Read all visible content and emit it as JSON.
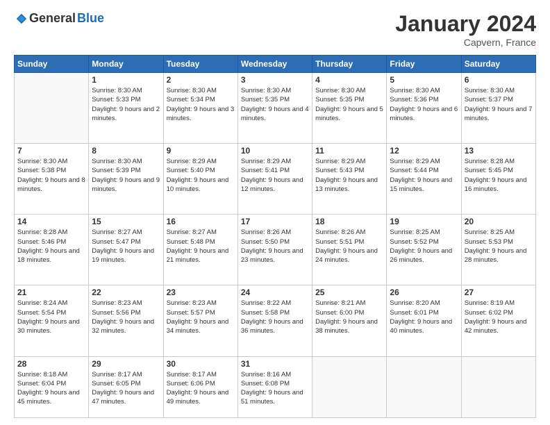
{
  "header": {
    "logo_general": "General",
    "logo_blue": "Blue",
    "month_title": "January 2024",
    "location": "Capvern, France"
  },
  "days_of_week": [
    "Sunday",
    "Monday",
    "Tuesday",
    "Wednesday",
    "Thursday",
    "Friday",
    "Saturday"
  ],
  "weeks": [
    [
      {
        "day": "",
        "sunrise": "",
        "sunset": "",
        "daylight": ""
      },
      {
        "day": "1",
        "sunrise": "Sunrise: 8:30 AM",
        "sunset": "Sunset: 5:33 PM",
        "daylight": "Daylight: 9 hours and 2 minutes."
      },
      {
        "day": "2",
        "sunrise": "Sunrise: 8:30 AM",
        "sunset": "Sunset: 5:34 PM",
        "daylight": "Daylight: 9 hours and 3 minutes."
      },
      {
        "day": "3",
        "sunrise": "Sunrise: 8:30 AM",
        "sunset": "Sunset: 5:35 PM",
        "daylight": "Daylight: 9 hours and 4 minutes."
      },
      {
        "day": "4",
        "sunrise": "Sunrise: 8:30 AM",
        "sunset": "Sunset: 5:35 PM",
        "daylight": "Daylight: 9 hours and 5 minutes."
      },
      {
        "day": "5",
        "sunrise": "Sunrise: 8:30 AM",
        "sunset": "Sunset: 5:36 PM",
        "daylight": "Daylight: 9 hours and 6 minutes."
      },
      {
        "day": "6",
        "sunrise": "Sunrise: 8:30 AM",
        "sunset": "Sunset: 5:37 PM",
        "daylight": "Daylight: 9 hours and 7 minutes."
      }
    ],
    [
      {
        "day": "7",
        "sunrise": "Sunrise: 8:30 AM",
        "sunset": "Sunset: 5:38 PM",
        "daylight": "Daylight: 9 hours and 8 minutes."
      },
      {
        "day": "8",
        "sunrise": "Sunrise: 8:30 AM",
        "sunset": "Sunset: 5:39 PM",
        "daylight": "Daylight: 9 hours and 9 minutes."
      },
      {
        "day": "9",
        "sunrise": "Sunrise: 8:29 AM",
        "sunset": "Sunset: 5:40 PM",
        "daylight": "Daylight: 9 hours and 10 minutes."
      },
      {
        "day": "10",
        "sunrise": "Sunrise: 8:29 AM",
        "sunset": "Sunset: 5:41 PM",
        "daylight": "Daylight: 9 hours and 12 minutes."
      },
      {
        "day": "11",
        "sunrise": "Sunrise: 8:29 AM",
        "sunset": "Sunset: 5:43 PM",
        "daylight": "Daylight: 9 hours and 13 minutes."
      },
      {
        "day": "12",
        "sunrise": "Sunrise: 8:29 AM",
        "sunset": "Sunset: 5:44 PM",
        "daylight": "Daylight: 9 hours and 15 minutes."
      },
      {
        "day": "13",
        "sunrise": "Sunrise: 8:28 AM",
        "sunset": "Sunset: 5:45 PM",
        "daylight": "Daylight: 9 hours and 16 minutes."
      }
    ],
    [
      {
        "day": "14",
        "sunrise": "Sunrise: 8:28 AM",
        "sunset": "Sunset: 5:46 PM",
        "daylight": "Daylight: 9 hours and 18 minutes."
      },
      {
        "day": "15",
        "sunrise": "Sunrise: 8:27 AM",
        "sunset": "Sunset: 5:47 PM",
        "daylight": "Daylight: 9 hours and 19 minutes."
      },
      {
        "day": "16",
        "sunrise": "Sunrise: 8:27 AM",
        "sunset": "Sunset: 5:48 PM",
        "daylight": "Daylight: 9 hours and 21 minutes."
      },
      {
        "day": "17",
        "sunrise": "Sunrise: 8:26 AM",
        "sunset": "Sunset: 5:50 PM",
        "daylight": "Daylight: 9 hours and 23 minutes."
      },
      {
        "day": "18",
        "sunrise": "Sunrise: 8:26 AM",
        "sunset": "Sunset: 5:51 PM",
        "daylight": "Daylight: 9 hours and 24 minutes."
      },
      {
        "day": "19",
        "sunrise": "Sunrise: 8:25 AM",
        "sunset": "Sunset: 5:52 PM",
        "daylight": "Daylight: 9 hours and 26 minutes."
      },
      {
        "day": "20",
        "sunrise": "Sunrise: 8:25 AM",
        "sunset": "Sunset: 5:53 PM",
        "daylight": "Daylight: 9 hours and 28 minutes."
      }
    ],
    [
      {
        "day": "21",
        "sunrise": "Sunrise: 8:24 AM",
        "sunset": "Sunset: 5:54 PM",
        "daylight": "Daylight: 9 hours and 30 minutes."
      },
      {
        "day": "22",
        "sunrise": "Sunrise: 8:23 AM",
        "sunset": "Sunset: 5:56 PM",
        "daylight": "Daylight: 9 hours and 32 minutes."
      },
      {
        "day": "23",
        "sunrise": "Sunrise: 8:23 AM",
        "sunset": "Sunset: 5:57 PM",
        "daylight": "Daylight: 9 hours and 34 minutes."
      },
      {
        "day": "24",
        "sunrise": "Sunrise: 8:22 AM",
        "sunset": "Sunset: 5:58 PM",
        "daylight": "Daylight: 9 hours and 36 minutes."
      },
      {
        "day": "25",
        "sunrise": "Sunrise: 8:21 AM",
        "sunset": "Sunset: 6:00 PM",
        "daylight": "Daylight: 9 hours and 38 minutes."
      },
      {
        "day": "26",
        "sunrise": "Sunrise: 8:20 AM",
        "sunset": "Sunset: 6:01 PM",
        "daylight": "Daylight: 9 hours and 40 minutes."
      },
      {
        "day": "27",
        "sunrise": "Sunrise: 8:19 AM",
        "sunset": "Sunset: 6:02 PM",
        "daylight": "Daylight: 9 hours and 42 minutes."
      }
    ],
    [
      {
        "day": "28",
        "sunrise": "Sunrise: 8:18 AM",
        "sunset": "Sunset: 6:04 PM",
        "daylight": "Daylight: 9 hours and 45 minutes."
      },
      {
        "day": "29",
        "sunrise": "Sunrise: 8:17 AM",
        "sunset": "Sunset: 6:05 PM",
        "daylight": "Daylight: 9 hours and 47 minutes."
      },
      {
        "day": "30",
        "sunrise": "Sunrise: 8:17 AM",
        "sunset": "Sunset: 6:06 PM",
        "daylight": "Daylight: 9 hours and 49 minutes."
      },
      {
        "day": "31",
        "sunrise": "Sunrise: 8:16 AM",
        "sunset": "Sunset: 6:08 PM",
        "daylight": "Daylight: 9 hours and 51 minutes."
      },
      {
        "day": "",
        "sunrise": "",
        "sunset": "",
        "daylight": ""
      },
      {
        "day": "",
        "sunrise": "",
        "sunset": "",
        "daylight": ""
      },
      {
        "day": "",
        "sunrise": "",
        "sunset": "",
        "daylight": ""
      }
    ]
  ]
}
